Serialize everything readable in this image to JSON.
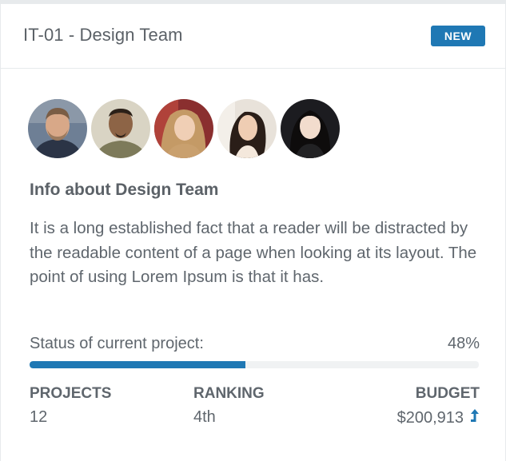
{
  "card": {
    "title": "IT-01 - Design Team",
    "badge": "NEW",
    "accent_color": "#1f78b4"
  },
  "team": {
    "avatars": [
      {
        "icon": "person-avatar-1"
      },
      {
        "icon": "person-avatar-2"
      },
      {
        "icon": "person-avatar-3"
      },
      {
        "icon": "person-avatar-4"
      },
      {
        "icon": "person-avatar-5"
      }
    ],
    "info_title": "Info about Design Team",
    "info_body": "It is a long established fact that a reader will be distracted by the readable content of a page when looking at its layout. The point of using Lorem Ipsum is that it has."
  },
  "status": {
    "label": "Status of current project:",
    "value_text": "48%",
    "progress_fraction": 0.48
  },
  "stats": {
    "projects_label": "PROJECTS",
    "projects_value": "12",
    "ranking_label": "RANKING",
    "ranking_value": "4th",
    "budget_label": "BUDGET",
    "budget_value": "$200,913",
    "budget_trend_icon": "arrow-up-icon"
  }
}
